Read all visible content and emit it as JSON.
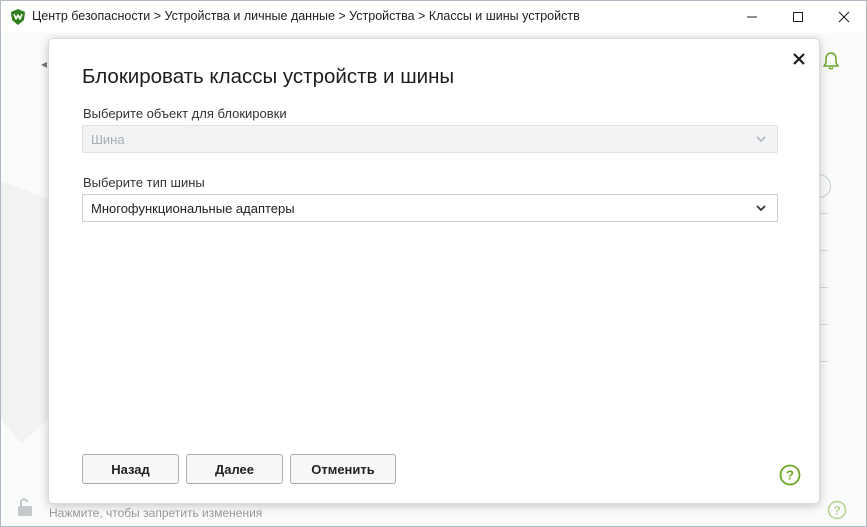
{
  "window": {
    "title": "Центр безопасности > Устройства и личные данные > Устройства > Классы и шины устройств",
    "min_icon": "minimize-icon",
    "max_icon": "maximize-icon",
    "close_icon": "close-icon"
  },
  "background": {
    "footer_text": "Нажмите, чтобы запретить изменения",
    "accent_color": "#6aa624"
  },
  "dialog": {
    "title": "Блокировать классы устройств и шины",
    "object_label": "Выберите объект для блокировки",
    "object_value": "Шина",
    "object_disabled": true,
    "bus_label": "Выберите тип шины",
    "bus_value": "Многофункциональные адаптеры",
    "buttons": {
      "back": "Назад",
      "next": "Далее",
      "cancel": "Отменить"
    },
    "help_icon": "help-icon"
  }
}
